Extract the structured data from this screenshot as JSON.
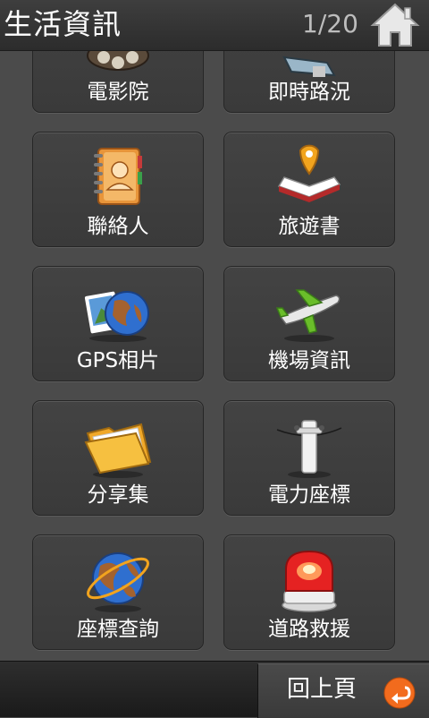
{
  "header": {
    "title": "生活資訊",
    "page_counter": "1/20",
    "home_icon": "home-icon"
  },
  "tiles": [
    {
      "label": "電影院",
      "icon": "film-reel-icon"
    },
    {
      "label": "即時路況",
      "icon": "traffic-camera-icon"
    },
    {
      "label": "聯絡人",
      "icon": "contacts-book-icon"
    },
    {
      "label": "旅遊書",
      "icon": "travel-book-icon"
    },
    {
      "label": "GPS相片",
      "icon": "gps-photo-icon"
    },
    {
      "label": "機場資訊",
      "icon": "airplane-icon"
    },
    {
      "label": "分享集",
      "icon": "folder-icon"
    },
    {
      "label": "電力座標",
      "icon": "utility-pole-icon"
    },
    {
      "label": "座標查詢",
      "icon": "globe-icon"
    },
    {
      "label": "道路救援",
      "icon": "siren-icon"
    }
  ],
  "footer": {
    "back_label": "回上頁",
    "back_icon": "back-arrow-icon"
  },
  "colors": {
    "accent": "#f26b1d",
    "background": "#4b4b4b"
  }
}
